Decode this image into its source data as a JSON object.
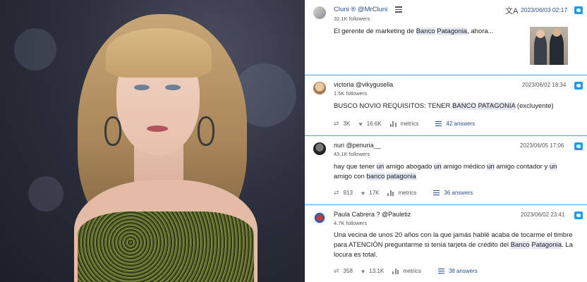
{
  "tweets": [
    {
      "author": "Cluni ® @MrCluni",
      "followers": "32.1K followers",
      "date": "2023/06/03 02:17",
      "text_parts": [
        "El gerente de marketing de ",
        "Banco",
        " ",
        "Patagonia",
        ", ahora..."
      ],
      "has_image": true
    },
    {
      "author": "victoria @vikygusella",
      "followers": "1.5K followers",
      "date": "2023/06/02 18:34",
      "text_parts": [
        "BUSCO NOVIO REQUISITOS: TENER ",
        "BANCO",
        " ",
        "PATAGONIA",
        " (excluyente)"
      ],
      "retweets": "3K",
      "likes": "16.6K",
      "metrics_label": "metrics",
      "answers": "42 answers"
    },
    {
      "author": "nuri @penuria__",
      "followers": "43.1K followers",
      "date": "2023/06/05 17:06",
      "text_parts": [
        "hay que tener ",
        "un",
        " amigo abogado ",
        "un",
        " amigo médico ",
        "un",
        " amigo contador y ",
        "un",
        " amigo con ",
        "banco",
        " ",
        "patagonia"
      ],
      "retweets": "913",
      "likes": "17K",
      "metrics_label": "metrics",
      "answers": "36 answers"
    },
    {
      "author": "Paula Cabrera ? @Pauletiz",
      "followers": "4.7K followers",
      "date": "2023/06/02 23:41",
      "text_parts": [
        "Una vecina de unos 20 años con la que jamás hablé acaba de tocarme el timbre para ATENCIÓN preguntarme si tenía tarjeta de crédito del ",
        "Banco",
        " ",
        "Patagonia",
        ". La locura es total."
      ],
      "retweets": "358",
      "likes": "13.1K",
      "metrics_label": "metrics",
      "answers": "38 answers"
    }
  ],
  "icons": {
    "list": "list-icon",
    "translate": "translate-icon",
    "bird": "twitter-bird-icon",
    "retweet": "retweet-icon",
    "like": "heart-icon",
    "metrics": "bar-chart-icon",
    "answers": "answers-icon"
  },
  "colors": {
    "link": "#2b4f8a",
    "divider": "#5b9bd5",
    "highlight": "#e4e8f3",
    "twitter": "#1d9bf0"
  }
}
